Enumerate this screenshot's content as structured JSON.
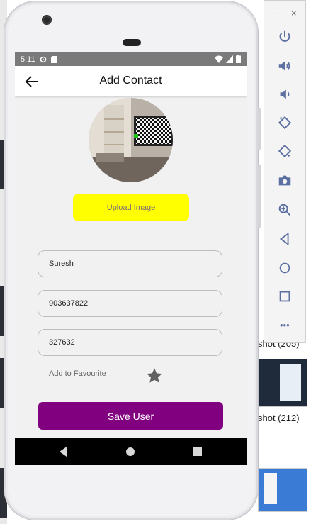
{
  "status_bar": {
    "time": "5:11"
  },
  "app_bar": {
    "title": "Add Contact"
  },
  "upload_button": {
    "label": "Upload Image"
  },
  "form": {
    "name": "Suresh",
    "phone": "903637822",
    "pin": "327632"
  },
  "favourite": {
    "label": "Add to Favourite"
  },
  "save_button": {
    "label": "Save User"
  },
  "emulator": {
    "minimize": "−",
    "close": "×",
    "more": "•••"
  },
  "background": {
    "snippet_1": "shot (205)",
    "snippet_2": "shot (212)"
  },
  "colors": {
    "accent_purple": "#800080",
    "upload_yellow": "#ffff00",
    "status_grey": "#7a7a7a"
  }
}
